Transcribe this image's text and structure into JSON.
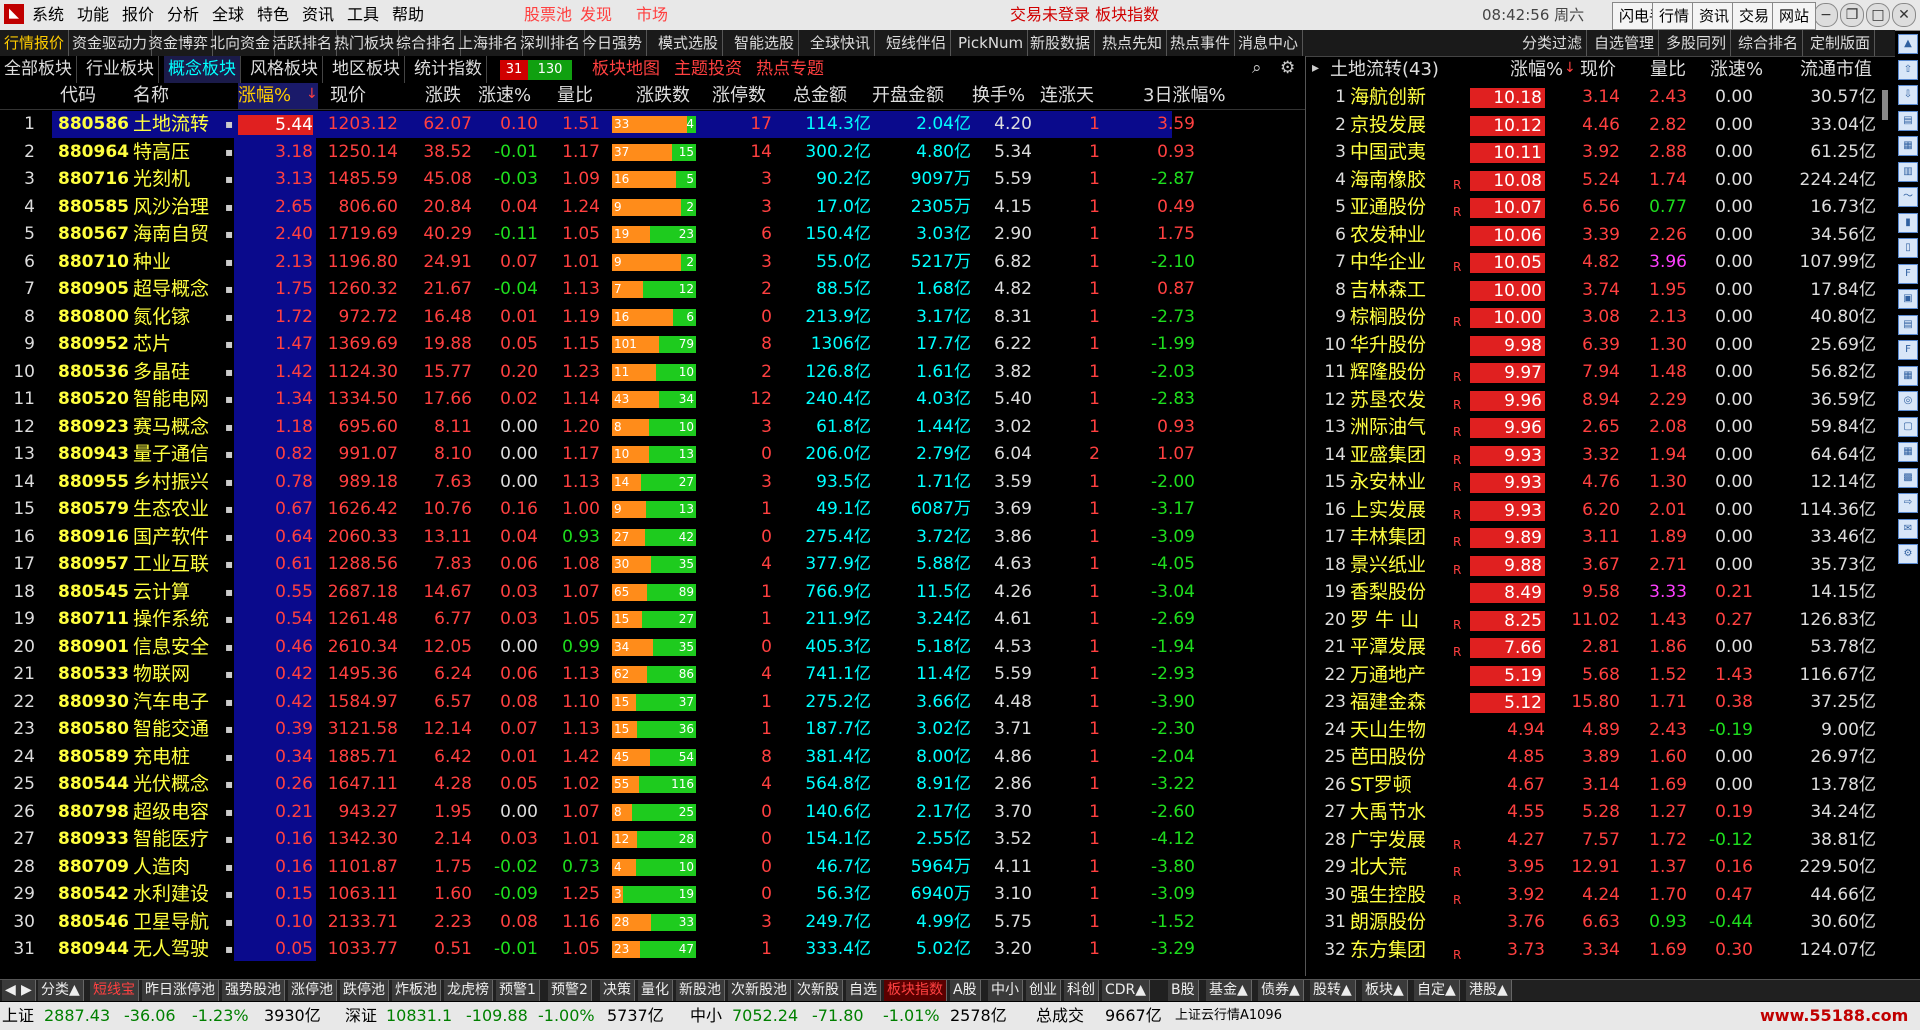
{
  "menu": [
    "系统",
    "功能",
    "报价",
    "分析",
    "全球",
    "特色",
    "资讯",
    "工具",
    "帮助"
  ],
  "menu_red": [
    "股票池",
    "发现",
    "市场"
  ],
  "login_text": "交易未登录  板块指数",
  "clock": "08:42:56 周六",
  "right_buttons": [
    "闪电手",
    "行情",
    "资讯",
    "交易",
    "网站"
  ],
  "tabs_top": [
    "行情报价",
    "资金驱动力",
    "资金博弈",
    "北向资金",
    "活跃排名",
    "热门板块",
    "综合排名",
    "上海排名",
    "深圳排名",
    "今日强势",
    "模式选股",
    "智能选股",
    "全球快讯",
    "短线伴侣",
    "PickNum",
    "新股数据",
    "热点先知",
    "热点事件",
    "消息中心",
    "分类过滤",
    "自选管理",
    "多股同列",
    "综合排名",
    "定制版面"
  ],
  "tabs_second": [
    "全部板块",
    "行业板块",
    "概念板块",
    "风格板块",
    "地区板块",
    "统计指数"
  ],
  "tabs_second_red": [
    "板块地图",
    "主题投资",
    "热点专题"
  ],
  "count_up": "31",
  "count_down": "130",
  "left_headers": [
    "代码",
    "名称",
    "涨幅%",
    "现价",
    "涨跌",
    "涨速%",
    "量比",
    "涨跌数",
    "涨停数",
    "总金额",
    "开盘金额",
    "换手%",
    "连涨天",
    "3日涨幅%"
  ],
  "right_headers": [
    "土地流转(43)",
    "涨幅%",
    "现价",
    "量比",
    "涨速%",
    "流通市值"
  ],
  "left_rows": [
    {
      "i": "1",
      "code": "880586",
      "name": "土地流转",
      "chg": "5.44",
      "price": "1203.12",
      "zd": "62.07",
      "spd": "0.10",
      "lb": "1.51",
      "up": "33",
      "down": "4",
      "zt": "17",
      "amt": "114.3亿",
      "open": "2.04亿",
      "hs": "4.20",
      "days": "1",
      "d3": "3.59"
    },
    {
      "i": "2",
      "code": "880964",
      "name": "特高压",
      "chg": "3.18",
      "price": "1250.14",
      "zd": "38.52",
      "spd": "-0.01",
      "lb": "1.17",
      "up": "37",
      "down": "15",
      "zt": "14",
      "amt": "300.2亿",
      "open": "4.80亿",
      "hs": "5.34",
      "days": "1",
      "d3": "0.93"
    },
    {
      "i": "3",
      "code": "880716",
      "name": "光刻机",
      "chg": "3.13",
      "price": "1485.59",
      "zd": "45.08",
      "spd": "-0.03",
      "lb": "1.09",
      "up": "16",
      "down": "5",
      "zt": "3",
      "amt": "90.2亿",
      "open": "9097万",
      "hs": "5.59",
      "days": "1",
      "d3": "-2.87"
    },
    {
      "i": "4",
      "code": "880585",
      "name": "风沙治理",
      "chg": "2.65",
      "price": "806.60",
      "zd": "20.84",
      "spd": "0.04",
      "lb": "1.24",
      "up": "9",
      "down": "2",
      "zt": "3",
      "amt": "17.0亿",
      "open": "2305万",
      "hs": "4.15",
      "days": "1",
      "d3": "0.49"
    },
    {
      "i": "5",
      "code": "880567",
      "name": "海南自贸",
      "chg": "2.40",
      "price": "1719.69",
      "zd": "40.29",
      "spd": "-0.11",
      "lb": "1.05",
      "up": "19",
      "down": "23",
      "zt": "6",
      "amt": "150.4亿",
      "open": "3.03亿",
      "hs": "2.90",
      "days": "1",
      "d3": "1.75"
    },
    {
      "i": "6",
      "code": "880710",
      "name": "种业",
      "chg": "2.13",
      "price": "1196.80",
      "zd": "24.91",
      "spd": "0.07",
      "lb": "1.01",
      "up": "9",
      "down": "2",
      "zt": "3",
      "amt": "55.0亿",
      "open": "5217万",
      "hs": "6.82",
      "days": "1",
      "d3": "-2.10"
    },
    {
      "i": "7",
      "code": "880905",
      "name": "超导概念",
      "chg": "1.75",
      "price": "1260.32",
      "zd": "21.67",
      "spd": "-0.04",
      "lb": "1.13",
      "up": "7",
      "down": "12",
      "zt": "2",
      "amt": "88.5亿",
      "open": "1.68亿",
      "hs": "4.82",
      "days": "1",
      "d3": "0.87"
    },
    {
      "i": "8",
      "code": "880800",
      "name": "氮化镓",
      "chg": "1.72",
      "price": "972.72",
      "zd": "16.48",
      "spd": "0.01",
      "lb": "1.19",
      "up": "16",
      "down": "6",
      "zt": "0",
      "amt": "213.9亿",
      "open": "3.17亿",
      "hs": "8.31",
      "days": "1",
      "d3": "-2.73"
    },
    {
      "i": "9",
      "code": "880952",
      "name": "芯片",
      "chg": "1.47",
      "price": "1369.69",
      "zd": "19.88",
      "spd": "0.05",
      "lb": "1.15",
      "up": "101",
      "down": "79",
      "zt": "8",
      "amt": "1306亿",
      "open": "17.7亿",
      "hs": "6.22",
      "days": "1",
      "d3": "-1.99"
    },
    {
      "i": "10",
      "code": "880536",
      "name": "多晶硅",
      "chg": "1.42",
      "price": "1124.30",
      "zd": "15.77",
      "spd": "0.20",
      "lb": "1.23",
      "up": "11",
      "down": "10",
      "zt": "2",
      "amt": "126.8亿",
      "open": "1.61亿",
      "hs": "3.82",
      "days": "1",
      "d3": "-2.03"
    },
    {
      "i": "11",
      "code": "880520",
      "name": "智能电网",
      "chg": "1.34",
      "price": "1334.50",
      "zd": "17.66",
      "spd": "0.02",
      "lb": "1.14",
      "up": "43",
      "down": "34",
      "zt": "12",
      "amt": "240.4亿",
      "open": "4.03亿",
      "hs": "5.40",
      "days": "1",
      "d3": "-2.83"
    },
    {
      "i": "12",
      "code": "880923",
      "name": "赛马概念",
      "chg": "1.18",
      "price": "695.60",
      "zd": "8.11",
      "spd": "0.00",
      "lb": "1.20",
      "up": "8",
      "down": "10",
      "zt": "3",
      "amt": "61.8亿",
      "open": "1.44亿",
      "hs": "3.02",
      "days": "1",
      "d3": "0.93"
    },
    {
      "i": "13",
      "code": "880943",
      "name": "量子通信",
      "chg": "0.82",
      "price": "991.07",
      "zd": "8.10",
      "spd": "0.00",
      "lb": "1.17",
      "up": "10",
      "down": "13",
      "zt": "0",
      "amt": "206.0亿",
      "open": "2.79亿",
      "hs": "6.04",
      "days": "2",
      "d3": "1.07"
    },
    {
      "i": "14",
      "code": "880955",
      "name": "乡村振兴",
      "chg": "0.78",
      "price": "989.18",
      "zd": "7.63",
      "spd": "0.00",
      "lb": "1.13",
      "up": "14",
      "down": "27",
      "zt": "3",
      "amt": "93.5亿",
      "open": "1.71亿",
      "hs": "3.59",
      "days": "1",
      "d3": "-2.00"
    },
    {
      "i": "15",
      "code": "880579",
      "name": "生态农业",
      "chg": "0.67",
      "price": "1626.42",
      "zd": "10.76",
      "spd": "0.16",
      "lb": "1.00",
      "up": "9",
      "down": "13",
      "zt": "1",
      "amt": "49.1亿",
      "open": "6087万",
      "hs": "3.69",
      "days": "1",
      "d3": "-3.17"
    },
    {
      "i": "16",
      "code": "880916",
      "name": "国产软件",
      "chg": "0.64",
      "price": "2060.33",
      "zd": "13.11",
      "spd": "0.04",
      "lb": "0.93",
      "up": "27",
      "down": "42",
      "zt": "0",
      "amt": "275.4亿",
      "open": "3.72亿",
      "hs": "3.86",
      "days": "1",
      "d3": "-3.09"
    },
    {
      "i": "17",
      "code": "880957",
      "name": "工业互联",
      "chg": "0.61",
      "price": "1288.56",
      "zd": "7.83",
      "spd": "0.06",
      "lb": "1.08",
      "up": "30",
      "down": "35",
      "zt": "4",
      "amt": "377.9亿",
      "open": "5.88亿",
      "hs": "4.63",
      "days": "1",
      "d3": "-4.05"
    },
    {
      "i": "18",
      "code": "880545",
      "name": "云计算",
      "chg": "0.55",
      "price": "2687.18",
      "zd": "14.67",
      "spd": "0.03",
      "lb": "1.07",
      "up": "65",
      "down": "89",
      "zt": "1",
      "amt": "766.9亿",
      "open": "11.5亿",
      "hs": "4.26",
      "days": "1",
      "d3": "-3.04"
    },
    {
      "i": "19",
      "code": "880711",
      "name": "操作系统",
      "chg": "0.54",
      "price": "1261.48",
      "zd": "6.77",
      "spd": "0.03",
      "lb": "1.05",
      "up": "15",
      "down": "27",
      "zt": "1",
      "amt": "211.9亿",
      "open": "3.24亿",
      "hs": "4.61",
      "days": "1",
      "d3": "-2.69"
    },
    {
      "i": "20",
      "code": "880901",
      "name": "信息安全",
      "chg": "0.46",
      "price": "2610.34",
      "zd": "12.05",
      "spd": "0.00",
      "lb": "0.99",
      "up": "34",
      "down": "35",
      "zt": "0",
      "amt": "405.3亿",
      "open": "5.18亿",
      "hs": "4.53",
      "days": "1",
      "d3": "-1.94"
    },
    {
      "i": "21",
      "code": "880533",
      "name": "物联网",
      "chg": "0.42",
      "price": "1495.36",
      "zd": "6.24",
      "spd": "0.06",
      "lb": "1.13",
      "up": "62",
      "down": "86",
      "zt": "4",
      "amt": "741.1亿",
      "open": "11.4亿",
      "hs": "5.59",
      "days": "1",
      "d3": "-2.93"
    },
    {
      "i": "22",
      "code": "880930",
      "name": "汽车电子",
      "chg": "0.42",
      "price": "1584.97",
      "zd": "6.57",
      "spd": "0.08",
      "lb": "1.10",
      "up": "15",
      "down": "37",
      "zt": "1",
      "amt": "275.2亿",
      "open": "3.66亿",
      "hs": "4.48",
      "days": "1",
      "d3": "-3.90"
    },
    {
      "i": "23",
      "code": "880580",
      "name": "智能交通",
      "chg": "0.39",
      "price": "3121.58",
      "zd": "12.14",
      "spd": "0.07",
      "lb": "1.13",
      "up": "15",
      "down": "36",
      "zt": "1",
      "amt": "187.7亿",
      "open": "3.02亿",
      "hs": "3.71",
      "days": "1",
      "d3": "-2.30"
    },
    {
      "i": "24",
      "code": "880589",
      "name": "充电桩",
      "chg": "0.34",
      "price": "1885.71",
      "zd": "6.42",
      "spd": "0.01",
      "lb": "1.42",
      "up": "45",
      "down": "54",
      "zt": "8",
      "amt": "381.4亿",
      "open": "8.00亿",
      "hs": "4.86",
      "days": "1",
      "d3": "-2.04"
    },
    {
      "i": "25",
      "code": "880544",
      "name": "光伏概念",
      "chg": "0.26",
      "price": "1647.11",
      "zd": "4.28",
      "spd": "0.05",
      "lb": "1.02",
      "up": "55",
      "down": "116",
      "zt": "4",
      "amt": "564.8亿",
      "open": "8.91亿",
      "hs": "2.86",
      "days": "1",
      "d3": "-3.22"
    },
    {
      "i": "26",
      "code": "880798",
      "name": "超级电容",
      "chg": "0.21",
      "price": "943.27",
      "zd": "1.95",
      "spd": "0.00",
      "lb": "1.07",
      "up": "8",
      "down": "25",
      "zt": "0",
      "amt": "140.6亿",
      "open": "2.17亿",
      "hs": "3.70",
      "days": "1",
      "d3": "-2.60"
    },
    {
      "i": "27",
      "code": "880933",
      "name": "智能医疗",
      "chg": "0.16",
      "price": "1342.30",
      "zd": "2.14",
      "spd": "0.03",
      "lb": "1.01",
      "up": "12",
      "down": "28",
      "zt": "0",
      "amt": "154.1亿",
      "open": "2.55亿",
      "hs": "3.52",
      "days": "1",
      "d3": "-4.12"
    },
    {
      "i": "28",
      "code": "880709",
      "name": "人造肉",
      "chg": "0.16",
      "price": "1101.87",
      "zd": "1.75",
      "spd": "-0.02",
      "lb": "0.73",
      "up": "4",
      "down": "10",
      "zt": "0",
      "amt": "46.7亿",
      "open": "5964万",
      "hs": "4.11",
      "days": "1",
      "d3": "-3.80"
    },
    {
      "i": "29",
      "code": "880542",
      "name": "水利建设",
      "chg": "0.15",
      "price": "1063.11",
      "zd": "1.60",
      "spd": "-0.09",
      "lb": "1.25",
      "up": "3",
      "down": "19",
      "zt": "0",
      "amt": "56.3亿",
      "open": "6940万",
      "hs": "3.10",
      "days": "1",
      "d3": "-3.09"
    },
    {
      "i": "30",
      "code": "880546",
      "name": "卫星导航",
      "chg": "0.10",
      "price": "2133.71",
      "zd": "2.23",
      "spd": "0.08",
      "lb": "1.16",
      "up": "28",
      "down": "33",
      "zt": "3",
      "amt": "249.7亿",
      "open": "4.99亿",
      "hs": "5.75",
      "days": "1",
      "d3": "-1.52"
    },
    {
      "i": "31",
      "code": "880944",
      "name": "无人驾驶",
      "chg": "0.05",
      "price": "1033.77",
      "zd": "0.51",
      "spd": "-0.01",
      "lb": "1.05",
      "up": "23",
      "down": "47",
      "zt": "1",
      "amt": "333.4亿",
      "open": "5.02亿",
      "hs": "3.20",
      "days": "1",
      "d3": "-3.29"
    }
  ],
  "right_rows": [
    {
      "i": "1",
      "name": "海航创新",
      "r": "",
      "chg": "10.18",
      "price": "3.14",
      "lb": "2.43",
      "spd": "0.00",
      "mv": "30.57亿"
    },
    {
      "i": "2",
      "name": "京投发展",
      "r": "",
      "chg": "10.12",
      "price": "4.46",
      "lb": "2.82",
      "spd": "0.00",
      "mv": "33.04亿"
    },
    {
      "i": "3",
      "name": "中国武夷",
      "r": "",
      "chg": "10.11",
      "price": "3.92",
      "lb": "2.88",
      "spd": "0.00",
      "mv": "61.25亿"
    },
    {
      "i": "4",
      "name": "海南橡胶",
      "r": "R",
      "chg": "10.08",
      "price": "5.24",
      "lb": "1.74",
      "spd": "0.00",
      "mv": "224.24亿"
    },
    {
      "i": "5",
      "name": "亚通股份",
      "r": "R",
      "chg": "10.07",
      "price": "6.56",
      "lb": "0.77",
      "spd": "0.00",
      "mv": "16.73亿"
    },
    {
      "i": "6",
      "name": "农发种业",
      "r": "",
      "chg": "10.06",
      "price": "3.39",
      "lb": "2.26",
      "spd": "0.00",
      "mv": "34.56亿"
    },
    {
      "i": "7",
      "name": "中华企业",
      "r": "R",
      "chg": "10.05",
      "price": "4.82",
      "lb": "3.96",
      "spd": "0.00",
      "mv": "107.99亿"
    },
    {
      "i": "8",
      "name": "吉林森工",
      "r": "",
      "chg": "10.00",
      "price": "3.74",
      "lb": "1.95",
      "spd": "0.00",
      "mv": "17.84亿"
    },
    {
      "i": "9",
      "name": "棕榈股份",
      "r": "R",
      "chg": "10.00",
      "price": "3.08",
      "lb": "2.13",
      "spd": "0.00",
      "mv": "40.80亿"
    },
    {
      "i": "10",
      "name": "华升股份",
      "r": "",
      "chg": "9.98",
      "price": "6.39",
      "lb": "1.30",
      "spd": "0.00",
      "mv": "25.69亿"
    },
    {
      "i": "11",
      "name": "辉隆股份",
      "r": "R",
      "chg": "9.97",
      "price": "7.94",
      "lb": "1.48",
      "spd": "0.00",
      "mv": "56.82亿"
    },
    {
      "i": "12",
      "name": "苏垦农发",
      "r": "R",
      "chg": "9.96",
      "price": "8.94",
      "lb": "2.29",
      "spd": "0.00",
      "mv": "36.59亿"
    },
    {
      "i": "13",
      "name": "洲际油气",
      "r": "R",
      "chg": "9.96",
      "price": "2.65",
      "lb": "2.08",
      "spd": "0.00",
      "mv": "59.84亿"
    },
    {
      "i": "14",
      "name": "亚盛集团",
      "r": "R",
      "chg": "9.93",
      "price": "3.32",
      "lb": "1.94",
      "spd": "0.00",
      "mv": "64.64亿"
    },
    {
      "i": "15",
      "name": "永安林业",
      "r": "R",
      "chg": "9.93",
      "price": "4.76",
      "lb": "1.30",
      "spd": "0.00",
      "mv": "12.14亿"
    },
    {
      "i": "16",
      "name": "上实发展",
      "r": "R",
      "chg": "9.93",
      "price": "6.20",
      "lb": "2.01",
      "spd": "0.00",
      "mv": "114.36亿"
    },
    {
      "i": "17",
      "name": "丰林集团",
      "r": "R",
      "chg": "9.89",
      "price": "3.11",
      "lb": "1.89",
      "spd": "0.00",
      "mv": "33.46亿"
    },
    {
      "i": "18",
      "name": "景兴纸业",
      "r": "R",
      "chg": "9.88",
      "price": "3.67",
      "lb": "2.71",
      "spd": "0.00",
      "mv": "35.73亿"
    },
    {
      "i": "19",
      "name": "香梨股份",
      "r": "",
      "chg": "8.49",
      "price": "9.58",
      "lb": "3.33",
      "spd": "0.21",
      "mv": "14.15亿"
    },
    {
      "i": "20",
      "name": "罗 牛 山",
      "r": "R",
      "chg": "8.25",
      "price": "11.02",
      "lb": "1.43",
      "spd": "0.27",
      "mv": "126.83亿"
    },
    {
      "i": "21",
      "name": "平潭发展",
      "r": "R",
      "chg": "7.66",
      "price": "2.81",
      "lb": "1.86",
      "spd": "0.00",
      "mv": "53.78亿"
    },
    {
      "i": "22",
      "name": "万通地产",
      "r": "",
      "chg": "5.19",
      "price": "5.68",
      "lb": "1.52",
      "spd": "1.43",
      "mv": "116.67亿"
    },
    {
      "i": "23",
      "name": "福建金森",
      "r": "",
      "chg": "5.12",
      "price": "15.80",
      "lb": "1.71",
      "spd": "0.38",
      "mv": "37.25亿"
    },
    {
      "i": "24",
      "name": "天山生物",
      "r": "",
      "chg": "4.94",
      "price": "4.89",
      "lb": "2.43",
      "spd": "-0.19",
      "mv": "9.00亿"
    },
    {
      "i": "25",
      "name": "芭田股份",
      "r": "",
      "chg": "4.85",
      "price": "3.89",
      "lb": "1.60",
      "spd": "0.00",
      "mv": "26.97亿"
    },
    {
      "i": "26",
      "name": "ST罗顿",
      "r": "",
      "chg": "4.67",
      "price": "3.14",
      "lb": "1.69",
      "spd": "0.00",
      "mv": "13.78亿"
    },
    {
      "i": "27",
      "name": "大禹节水",
      "r": "",
      "chg": "4.55",
      "price": "5.28",
      "lb": "1.27",
      "spd": "0.19",
      "mv": "34.24亿"
    },
    {
      "i": "28",
      "name": "广宇发展",
      "r": "R",
      "chg": "4.27",
      "price": "7.57",
      "lb": "1.72",
      "spd": "-0.12",
      "mv": "38.81亿"
    },
    {
      "i": "29",
      "name": "北大荒",
      "r": "R",
      "chg": "3.95",
      "price": "12.91",
      "lb": "1.37",
      "spd": "0.16",
      "mv": "229.50亿"
    },
    {
      "i": "30",
      "name": "强生控股",
      "r": "R",
      "chg": "3.92",
      "price": "4.24",
      "lb": "1.70",
      "spd": "0.47",
      "mv": "44.66亿"
    },
    {
      "i": "31",
      "name": "朗源股份",
      "r": "",
      "chg": "3.76",
      "price": "6.63",
      "lb": "0.93",
      "spd": "-0.44",
      "mv": "30.60亿"
    },
    {
      "i": "32",
      "name": "东方集团",
      "r": "R",
      "chg": "3.73",
      "price": "3.34",
      "lb": "1.69",
      "spd": "0.30",
      "mv": "124.07亿"
    }
  ],
  "bottom_tabs": [
    "分类▲",
    "短线宝",
    "昨日涨停池",
    "强势股池",
    "涨停池",
    "跌停池",
    "炸板池",
    "龙虎榜",
    "预警1",
    "预警2",
    "决策",
    "量化",
    "新股池",
    "次新股池",
    "次新股",
    "自选",
    "板块指数",
    "A股",
    "中小",
    "创业",
    "科创",
    "CDR▲",
    "B股",
    "基金▲",
    "债券▲",
    "股转▲",
    "板块▲",
    "自定▲",
    "港股▲"
  ],
  "status": {
    "sh_label": "上证",
    "sh_val": "2887.43",
    "sh_chg": "-36.06",
    "sh_pct": "-1.23%",
    "sh_amt": "3930亿",
    "sz_label": "深证",
    "sz_val": "10831.1",
    "sz_chg": "-109.88",
    "sz_pct": "-1.00%",
    "sz_amt": "5737亿",
    "zx_label": "中小",
    "zx_val": "7052.24",
    "zx_chg": "-71.80",
    "zx_pct": "-1.01%",
    "zx_amt": "2578亿",
    "total_label": "总成交",
    "total_val": "9667亿",
    "server": "上证云行情A1096",
    "watermark": "www.55188.com"
  },
  "colors": {
    "up": "#ff4040",
    "down": "#1ede1e",
    "flat": "#dddddd",
    "name": "#ffff40",
    "amount": "#00ffff",
    "selected_row": "#0a0a8c",
    "bar_up": "#ff8c1a",
    "bar_down": "#1ecb1e"
  }
}
